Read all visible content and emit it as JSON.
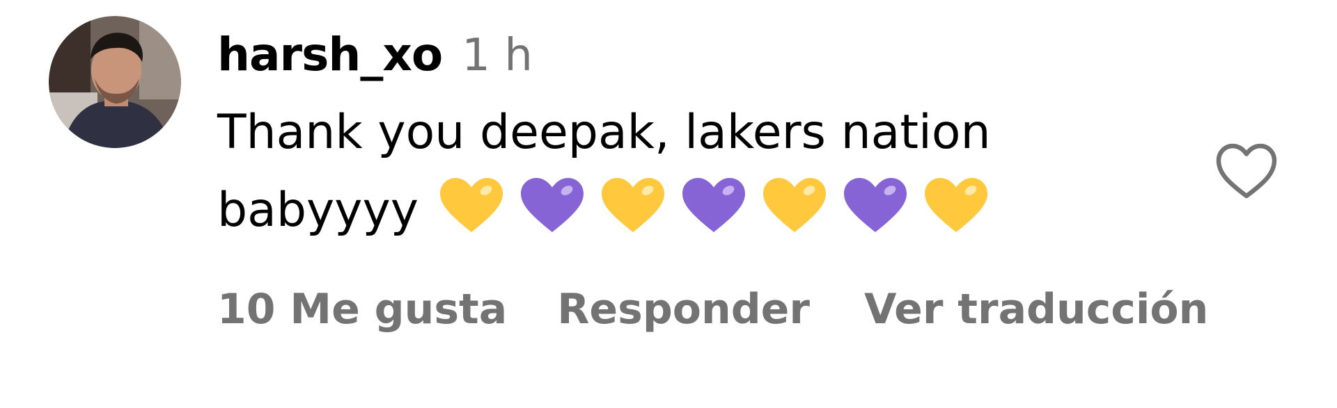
{
  "comment": {
    "username": "harsh_xo",
    "timestamp": "1 h",
    "text": "Thank you deepak, lakers nation babyyyy",
    "emoji_sequence": [
      "yellow-heart",
      "purple-heart",
      "yellow-heart",
      "purple-heart",
      "yellow-heart",
      "purple-heart",
      "yellow-heart"
    ],
    "actions": {
      "likes_label": "10 Me gusta",
      "reply_label": "Responder",
      "translate_label": "Ver traducción"
    },
    "like_icon": "heart-outline-icon"
  },
  "colors": {
    "text": "#000000",
    "secondary_text": "#737373",
    "yellow_heart": "#FFC83D",
    "purple_heart": "#8764D6",
    "like_outline": "#737373"
  }
}
